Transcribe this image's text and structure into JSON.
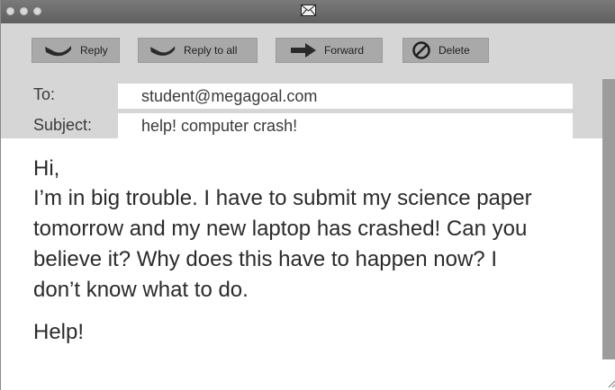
{
  "toolbar": {
    "reply_label": "Reply",
    "reply_all_label": "Reply to all",
    "forward_label": "Forward",
    "delete_label": "Delete"
  },
  "header": {
    "to_label": "To:",
    "to_value": "student@megagoal.com",
    "subject_label": "Subject:",
    "subject_value": "help! computer crash!"
  },
  "message": {
    "greeting": "Hi,",
    "lines": [
      "I’m in big trouble. I have to submit my science paper",
      "tomorrow and my new laptop has crashed! Can you",
      "believe it? Why does this have to happen now? I",
      "don’t know what to do."
    ],
    "closing": "Help!"
  },
  "colors": {
    "titlebar": "#6e6e6e",
    "toolbar_bg": "#d6d6d6",
    "button_bg": "#a9a9a9",
    "scrollbar": "#9c9c9c"
  }
}
